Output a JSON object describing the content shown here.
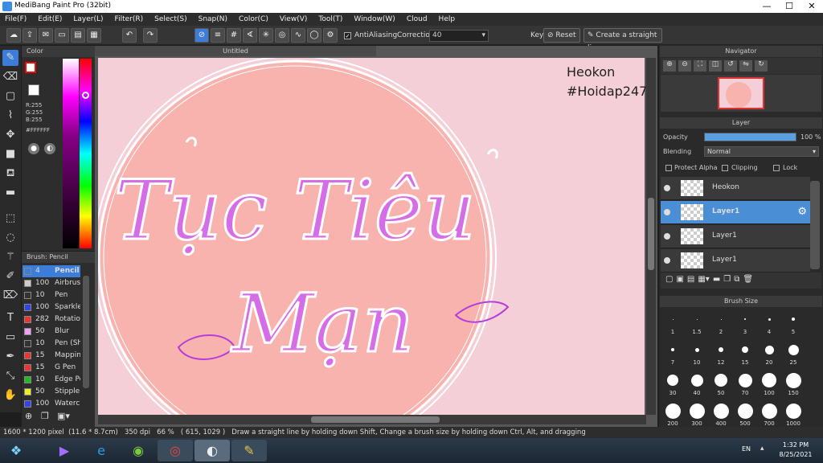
{
  "window": {
    "title": "MediBang Paint Pro (32bit)",
    "controls": [
      "—",
      "☐",
      "✕"
    ]
  },
  "menu": [
    "File(F)",
    "Edit(E)",
    "Layer(L)",
    "Filter(R)",
    "Select(S)",
    "Snap(N)",
    "Color(C)",
    "View(V)",
    "Tool(T)",
    "Window(W)",
    "Cloud",
    "Help"
  ],
  "toolbar": {
    "antialiasing_label": "AntiAliasing",
    "correction_label": "Correction",
    "correction_value": "40",
    "key_label": "Key",
    "reset_label": "Reset",
    "straight_line_label": "Create a straight line"
  },
  "color_panel": {
    "title": "Color",
    "r": "R:255",
    "g": "G:255",
    "b": "B:255",
    "hex": "#FFFFFF",
    "foreground": "#ff0000",
    "background": "#ffffff"
  },
  "brush_panel": {
    "title": "Brush: Pencil",
    "items": [
      {
        "size": "4",
        "name": "Pencil",
        "color": "#3b7dd8"
      },
      {
        "size": "100",
        "name": "Airbrush",
        "color": "#cccccc"
      },
      {
        "size": "10",
        "name": "Pen",
        "color": "#333333"
      },
      {
        "size": "100",
        "name": "Sparkle",
        "color": "#3344ee"
      },
      {
        "size": "282",
        "name": "Rotation",
        "color": "#ee3333"
      },
      {
        "size": "50",
        "name": "Blur",
        "color": "#f0a0f0"
      },
      {
        "size": "10",
        "name": "Pen (Sh",
        "color": "#333333"
      },
      {
        "size": "15",
        "name": "Mapping",
        "color": "#ee3333"
      },
      {
        "size": "15",
        "name": "G Pen",
        "color": "#ee3333"
      },
      {
        "size": "10",
        "name": "Edge Pe",
        "color": "#22bb22"
      },
      {
        "size": "50",
        "name": "Stipple",
        "color": "#eeee22"
      },
      {
        "size": "100",
        "name": "Waterc",
        "color": "#3344ee"
      }
    ]
  },
  "document": {
    "tab": "Untitled",
    "art_line1": "Tục Tiêu",
    "art_line2": "Mạn",
    "signature_name": "Heokon",
    "signature_tag": "#Hoidap247"
  },
  "navigator": {
    "title": "Navigator"
  },
  "layer_panel": {
    "title": "Layer",
    "opacity_label": "Opacity",
    "opacity_value": "100 %",
    "opacity": 1.0,
    "blending_label": "Blending",
    "blending_value": "Normal",
    "protect_alpha": "Protect Alpha",
    "clipping": "Clipping",
    "lock": "Lock",
    "layers": [
      {
        "name": "Heokon",
        "selected": false
      },
      {
        "name": "Layer1",
        "selected": true
      },
      {
        "name": "Layer1",
        "selected": false
      },
      {
        "name": "Layer1",
        "selected": false
      }
    ]
  },
  "brush_size_panel": {
    "title": "Brush Size",
    "sizes": [
      "1",
      "1.5",
      "2",
      "3",
      "4",
      "5",
      "7",
      "10",
      "12",
      "15",
      "20",
      "25",
      "30",
      "40",
      "50",
      "70",
      "100",
      "150",
      "200",
      "300",
      "400",
      "500",
      "700",
      "1000"
    ]
  },
  "status_bar": {
    "size": "1600 * 1200 pixel",
    "cm": "(11.6 * 8.7cm)",
    "dpi": "350 dpi",
    "zoom": "66 %",
    "coords": "( 615, 1029 )",
    "hint": "Draw a straight line by holding down Shift, Change a brush size by holding down Ctrl, Alt, and dragging"
  },
  "taskbar": {
    "lang": "EN",
    "time": "1:32 PM",
    "date": "8/25/2021"
  }
}
